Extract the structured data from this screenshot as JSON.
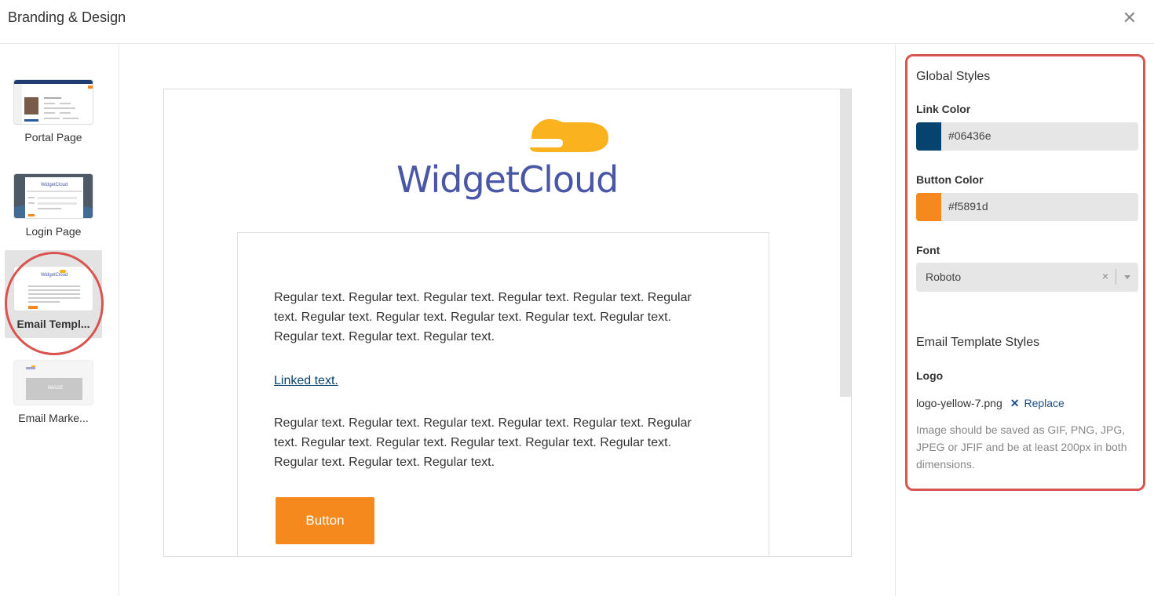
{
  "header": {
    "title": "Branding & Design",
    "close_glyph": "✕"
  },
  "nav": {
    "items": [
      {
        "label": "Portal Page"
      },
      {
        "label": "Login Page"
      },
      {
        "label": "Email Templ..."
      },
      {
        "label": "Email Marke..."
      }
    ],
    "active_index": 2,
    "thumb_login_logo": "WidgetCloud",
    "thumb_email_logo": "WidgetCloud",
    "thumb_marketing_image": "IMAGE"
  },
  "preview": {
    "logo_text": "WidgetCloud",
    "paragraph1": "Regular text. Regular text. Regular text. Regular text. Regular text. Regular text. Regular text. Regular text. Regular text. Regular text. Regular text. Regular text. Regular text. Regular text.",
    "link_text": "Linked text",
    "link_suffix": ".",
    "paragraph2": "Regular text. Regular text. Regular text. Regular text. Regular text. Regular text. Regular text. Regular text. Regular text. Regular text. Regular text. Regular text. Regular text. Regular text.",
    "button_label": "Button"
  },
  "global_styles": {
    "title": "Global Styles",
    "link_color": {
      "label": "Link Color",
      "value": "#06436e"
    },
    "button_color": {
      "label": "Button Color",
      "value": "#f5891d"
    },
    "font": {
      "label": "Font",
      "value": "Roboto",
      "clear_glyph": "×"
    }
  },
  "email_template_styles": {
    "title": "Email Template Styles",
    "logo": {
      "label": "Logo",
      "filename": "logo-yellow-7.png",
      "remove_glyph": "✕",
      "replace_label": "Replace",
      "help": "Image should be saved as GIF, PNG, JPG, JPEG or JFIF and be at least 200px in both dimensions."
    }
  },
  "colors": {
    "logo_cloud": "#fbb21f",
    "logo_text": "#4a57a6",
    "highlight": "#d9534f"
  }
}
